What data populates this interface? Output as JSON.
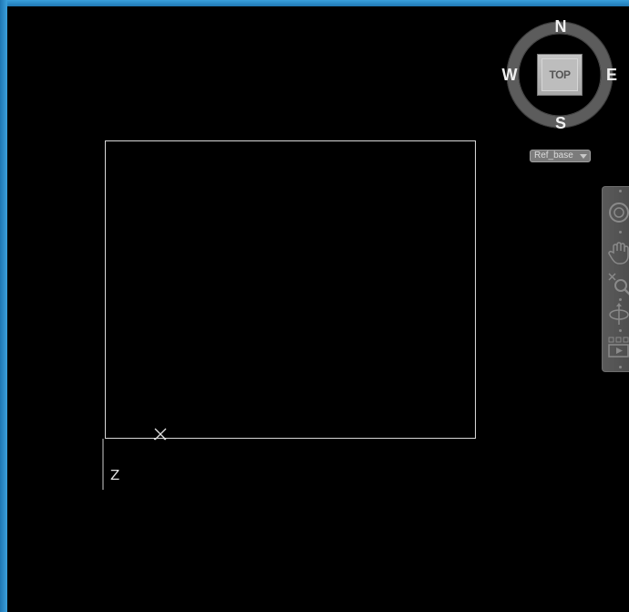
{
  "viewcube": {
    "north": "N",
    "south": "S",
    "east": "E",
    "west": "W",
    "face": "TOP"
  },
  "wcs_menu": {
    "label": "Ref_base"
  },
  "ucs": {
    "axis_label": "Z"
  },
  "navigation_bar": {
    "tools": [
      "steering-wheel",
      "pan",
      "zoom",
      "orbit",
      "showmotion"
    ]
  },
  "colors": {
    "frame": "#2a8fd0",
    "canvas": "#000000",
    "geometry": "#d8d8d8",
    "viewcube_ring": "#5c5c5c",
    "viewcube_face": "#bdbdbd"
  }
}
